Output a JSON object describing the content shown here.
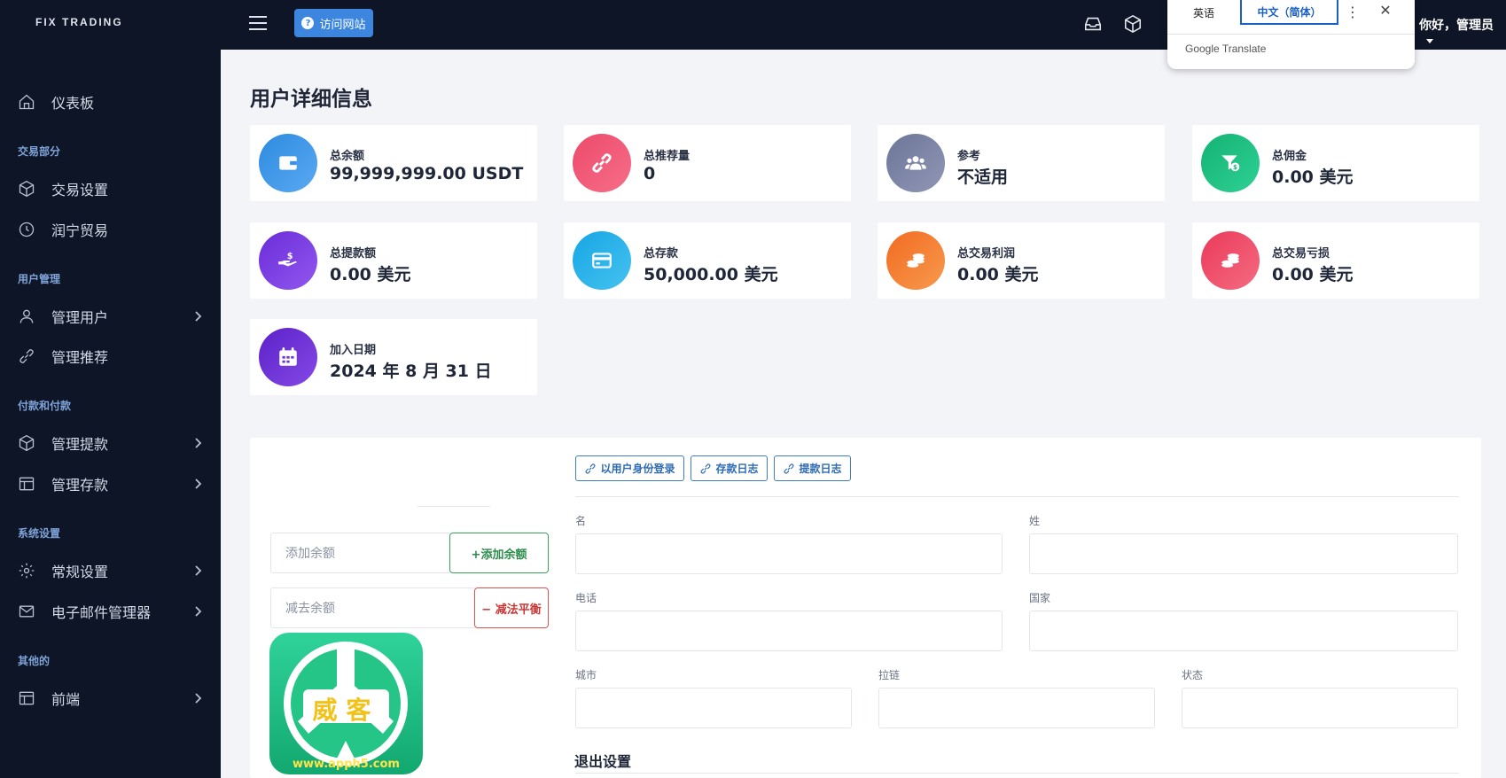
{
  "brand": "FIX TRADING",
  "sidebar": {
    "dashboard": "仪表板",
    "sections": [
      {
        "title": "交易部分",
        "items": [
          {
            "label": "交易设置"
          },
          {
            "label": "润宁贸易"
          }
        ]
      },
      {
        "title": "用户管理",
        "items": [
          {
            "label": "管理用户"
          },
          {
            "label": "管理推荐"
          }
        ]
      },
      {
        "title": "付款和付款",
        "items": [
          {
            "label": "管理提款"
          },
          {
            "label": "管理存款"
          }
        ]
      },
      {
        "title": "系统设置",
        "items": [
          {
            "label": "常规设置"
          },
          {
            "label": "电子邮件管理器"
          }
        ]
      },
      {
        "title": "其他的",
        "items": [
          {
            "label": "前端"
          }
        ]
      }
    ]
  },
  "topbar": {
    "visit_label": "访问网站",
    "greeting": "你好，管理员"
  },
  "translate": {
    "lang1": "英语",
    "lang2": "中文（简体）",
    "more": "⋮",
    "close": "✕",
    "brand": "Google Translate"
  },
  "page_title": "用户详细信息",
  "stats": [
    {
      "label": "总余额",
      "value": "99,999,999.00 USDT",
      "icon": "wallet-icon",
      "color1": "#2d8be0",
      "color2": "#5aa9f2"
    },
    {
      "label": "总推荐量",
      "value": "0",
      "icon": "link-icon",
      "color1": "#ee4a6b",
      "color2": "#f56e87"
    },
    {
      "label": "参考",
      "value": "不适用",
      "icon": "users-icon",
      "color1": "#6d7699",
      "color2": "#9096b5"
    },
    {
      "label": "总佣金",
      "value": "0.00 美元",
      "icon": "funnel-dollar-icon",
      "color1": "#13b374",
      "color2": "#2fd094"
    },
    {
      "label": "总提款额",
      "value": "0.00 美元",
      "icon": "hand-dollar-icon",
      "color1": "#6a2dd8",
      "color2": "#9157ef"
    },
    {
      "label": "总存款",
      "value": "50,000.00 美元",
      "icon": "credit-card-icon",
      "color1": "#17a6e4",
      "color2": "#45c2f0"
    },
    {
      "label": "总交易利润",
      "value": "0.00 美元",
      "icon": "coins-icon",
      "color1": "#f26b21",
      "color2": "#f79a4e"
    },
    {
      "label": "总交易亏损",
      "value": "0.00 美元",
      "icon": "coins-loss-icon",
      "color1": "#ea3a5a",
      "color2": "#f56b81"
    },
    {
      "label": "加入日期",
      "value": "2024 年 8 月 31 日",
      "icon": "calendar-icon",
      "color1": "#5b22c9",
      "color2": "#8648e6"
    }
  ],
  "balance": {
    "add_placeholder": "添加余额",
    "add_button": "+添加余额",
    "sub_placeholder": "减去余额",
    "sub_button": "− 减法平衡"
  },
  "actions": {
    "login_as": "以用户身份登录",
    "deposit_log": "存款日志",
    "withdraw_log": "提款日志"
  },
  "form": {
    "first_name": "名",
    "last_name": "姓",
    "phone": "电话",
    "country": "国家",
    "city": "城市",
    "zip": "拉链",
    "state": "状态",
    "logout_settings": "退出设置"
  },
  "watermark": {
    "text": "威客",
    "url": "www.apph5.com"
  },
  "colors": {
    "sidebar_bg": "#0e1526",
    "accent": "#3d86e0",
    "section_title": "#7ea3d8"
  }
}
